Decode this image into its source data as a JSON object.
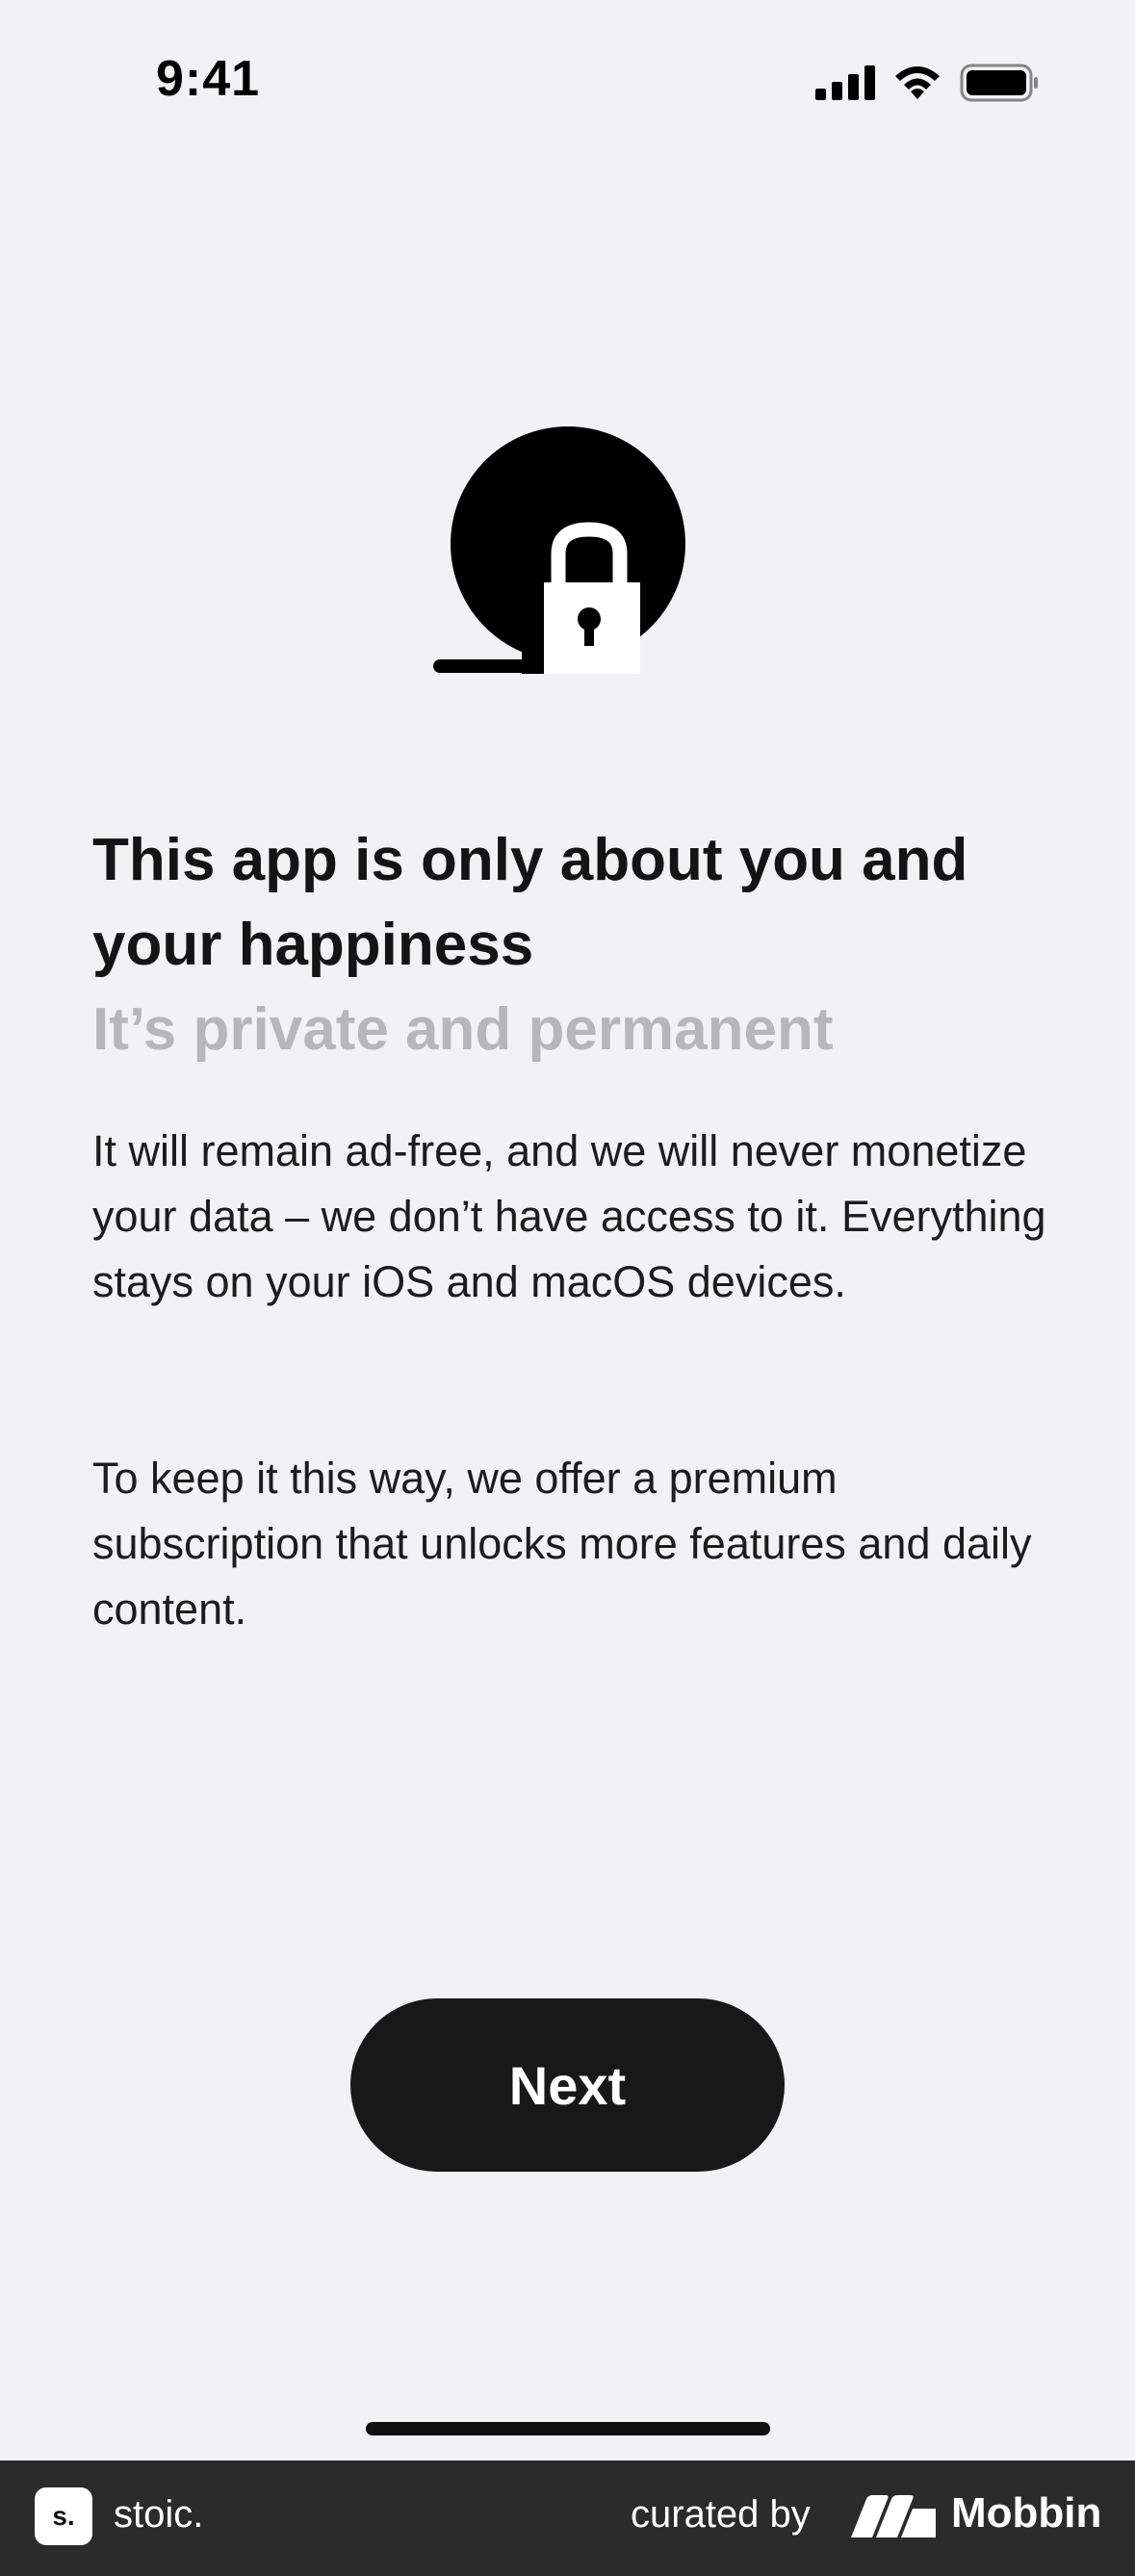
{
  "status_bar": {
    "time": "9:41"
  },
  "hero": {
    "icon": "lock-icon"
  },
  "content": {
    "headline": "This app is only about you and your happiness",
    "subheadline": "It’s private and permanent",
    "paragraph_1": "It will remain ad-free, and we will never monetize your data – we don’t have access to it. Everything stays on your iOS and macOS devices.",
    "paragraph_2": "To keep it this way, we offer a premium subscription that unlocks more features and daily content."
  },
  "actions": {
    "next_label": "Next"
  },
  "footer": {
    "app_badge": "s.",
    "app_name": "stoic.",
    "curated_by": "curated by",
    "brand": "Mobbin"
  },
  "colors": {
    "background": "#f2f2f4",
    "primary": "#181818",
    "muted": "#b7b7b9"
  }
}
